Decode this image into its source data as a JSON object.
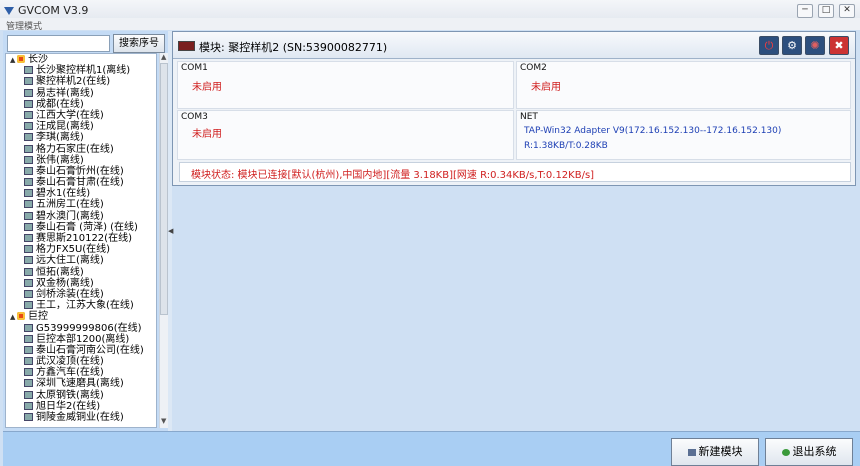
{
  "window": {
    "title": "GVCOM  V3.9",
    "menu": "管理模式",
    "min": "─",
    "max": "□",
    "close": "✕"
  },
  "sidebar": {
    "search_placeholder": "",
    "search_button": "搜索序号",
    "groups": [
      {
        "label": "长沙",
        "expand": "▲",
        "items": [
          "长沙聚控样机1(离线)",
          "聚控样机2(在线)",
          "易志祥(离线)",
          "成都(在线)",
          "江西大学(在线)",
          "汪成昆(离线)",
          "李琪(离线)",
          "格力石家庄(在线)",
          "张伟(离线)",
          "泰山石膏忻州(在线)",
          "泰山石膏甘肃(在线)",
          "碧水1(在线)",
          "五洲房工(在线)",
          "碧水澳门(离线)",
          "泰山石膏 (菏泽) (在线)",
          "赛思斯210122(在线)",
          "格力FX5U(在线)",
          "远大住工(离线)",
          "恒拓(离线)",
          "双金杨(离线)",
          "剑桥涂装(在线)",
          "王工，江苏大象(在线)"
        ]
      },
      {
        "label": "巨控",
        "expand": "▲",
        "items": [
          "G53999999806(在线)",
          "巨控本部1200(离线)",
          "泰山石膏河南公司(在线)",
          "武汉凌顶(在线)",
          "方鑫汽车(在线)",
          "深圳飞速磨具(离线)",
          "太原钢铁(离线)",
          "旭日华2(在线)",
          "铜陵金威铜业(在线)"
        ]
      }
    ]
  },
  "module": {
    "title": "模块: 聚控样机2 (SN:53900082771)",
    "com1": {
      "label": "COM1",
      "value": "未启用"
    },
    "com2": {
      "label": "COM2",
      "value": "未启用"
    },
    "com3": {
      "label": "COM3",
      "value": "未启用"
    },
    "net": {
      "label": "NET",
      "line1": "TAP-Win32 Adapter V9(172.16.152.130--172.16.152.130)",
      "line2": "R:1.38KB/T:0.28KB"
    },
    "status": "模块状态: 模块已连接[默认(杭州),中国内地][流量 3.18KB][网速 R:0.34KB/s,T:0.12KB/s]"
  },
  "footer": {
    "new_module": "新建模块",
    "exit": "退出系统"
  }
}
